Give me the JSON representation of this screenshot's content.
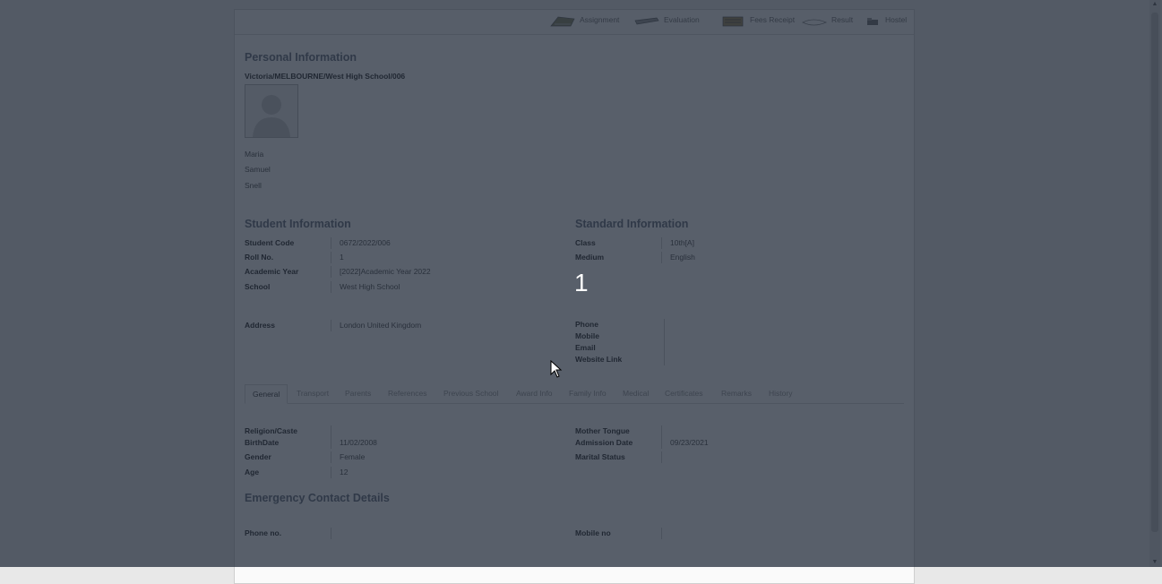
{
  "toolbar": {
    "items": [
      {
        "label": "Assignment",
        "icon": "assignment-icon"
      },
      {
        "label": "Evaluation",
        "icon": "evaluation-icon"
      },
      {
        "label": "Fees Receipt",
        "icon": "fees-receipt-icon"
      },
      {
        "label": "Result",
        "icon": "result-icon"
      },
      {
        "label": "Hostel",
        "icon": "hostel-icon"
      }
    ]
  },
  "personal": {
    "title": "Personal Information",
    "code_path": "Victoria/MELBOURNE/West High School/006",
    "first_name": "Maria",
    "middle_name": "Samuel",
    "last_name": "Snell"
  },
  "student_info": {
    "title": "Student Information",
    "rows": [
      {
        "label": "Student Code",
        "value": "0672/2022/006"
      },
      {
        "label": "Roll No.",
        "value": "1"
      },
      {
        "label": "Academic Year",
        "value": "[2022]Academic Year 2022"
      },
      {
        "label": "School",
        "value": "West High School"
      }
    ]
  },
  "standard_info": {
    "title": "Standard Information",
    "rows": [
      {
        "label": "Class",
        "value": "10th[A]"
      },
      {
        "label": "Medium",
        "value": "English"
      }
    ]
  },
  "address": {
    "label": "Address",
    "value": "London  United Kingdom"
  },
  "contact": {
    "labels": [
      "Phone",
      "Mobile",
      "Email",
      "Website Link"
    ]
  },
  "tabs": [
    "General",
    "Transport",
    "Parents",
    "References",
    "Previous School",
    "Award Info",
    "Family Info",
    "Medical",
    "Certificates",
    "Remarks",
    "History"
  ],
  "general": {
    "left": [
      {
        "label": "Religion/Caste",
        "value": ""
      },
      {
        "label": "BirthDate",
        "value": "11/02/2008"
      },
      {
        "label": "Gender",
        "value": "Female"
      },
      {
        "label": "Age",
        "value": "12"
      }
    ],
    "right": [
      {
        "label": "Mother Tongue",
        "value": ""
      },
      {
        "label": "Admission Date",
        "value": "09/23/2021"
      },
      {
        "label": "Marital Status",
        "value": ""
      }
    ]
  },
  "emergency": {
    "title": "Emergency Contact Details",
    "phone_label": "Phone no.",
    "mobile_label": "Mobile no"
  },
  "overlay": {
    "step_number": "1",
    "color": "#192332"
  }
}
